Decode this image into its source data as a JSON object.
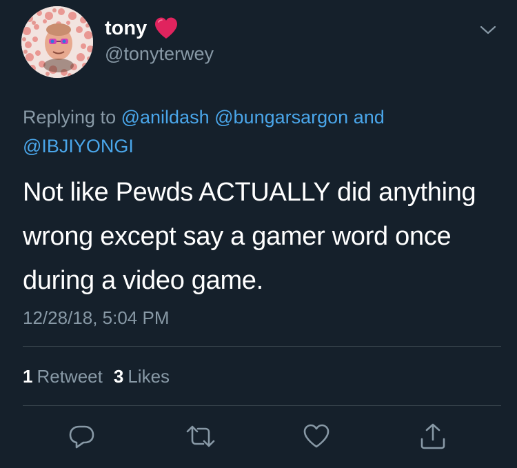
{
  "author": {
    "display_name": "tony",
    "name_emoji": "heart-emoji",
    "handle": "@tonyterwey"
  },
  "reply_context": {
    "prefix": "Replying to",
    "mentions": [
      "@anildash",
      "@bungarsargon"
    ],
    "conjunction": "and",
    "last_mention": "@IBJIYONGI"
  },
  "tweet": {
    "text": "Not like Pewds ACTUALLY did anything wrong except say a gamer word once during a video game.",
    "timestamp": "12/28/18, 5:04 PM"
  },
  "stats": {
    "retweets": {
      "count": "1",
      "label": "Retweet"
    },
    "likes": {
      "count": "3",
      "label": "Likes"
    }
  },
  "actions": {
    "reply_icon": "reply-icon",
    "retweet_icon": "retweet-icon",
    "like_icon": "heart-icon",
    "share_icon": "share-icon"
  },
  "colors": {
    "background": "#15202b",
    "primary_text": "#ffffff",
    "secondary_text": "#8899a6",
    "link": "#4aa6ea",
    "divider": "#38444d",
    "heart_emoji": "#e0245e"
  }
}
